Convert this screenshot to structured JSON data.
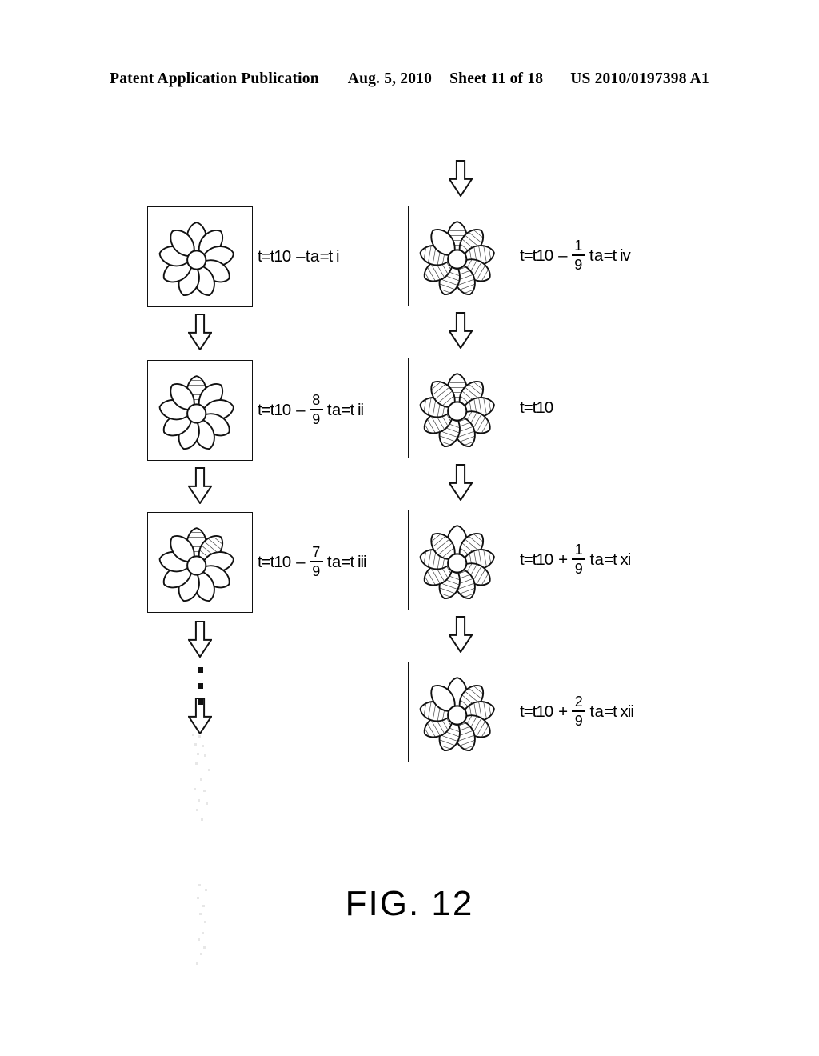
{
  "header": {
    "publication": "Patent Application Publication",
    "date": "Aug. 5, 2010",
    "sheet": "Sheet 11 of 18",
    "number": "US 2010/0197398 A1"
  },
  "figure_caption": "FIG. 12",
  "petal_count": 9,
  "icons": {
    "down_arrow": "down-arrow-icon",
    "vertical_ellipsis": "vertical-ellipsis-icon"
  },
  "colors": {
    "ink": "#111111",
    "paper": "#ffffff"
  },
  "columns": [
    {
      "name": "left-column",
      "cells": [
        {
          "id": "cell-t-i",
          "hatched_petals": 0,
          "label": {
            "prefix": "t=t10",
            "operator": "–",
            "fraction": null,
            "middle": "ta",
            "suffix": "=t i",
            "text": "t=t10 – ta=t i"
          }
        },
        {
          "id": "cell-t-ii",
          "hatched_petals": 1,
          "label": {
            "prefix": "t=t10",
            "operator": "–",
            "fraction": {
              "numerator": "8",
              "denominator": "9"
            },
            "middle": "ta",
            "suffix": "=t ii",
            "text": "t=t10 – 8/9 ta=t ii"
          }
        },
        {
          "id": "cell-t-iii",
          "hatched_petals": 2,
          "label": {
            "prefix": "t=t10",
            "operator": "–",
            "fraction": {
              "numerator": "7",
              "denominator": "9"
            },
            "middle": "ta",
            "suffix": "=t iii",
            "text": "t=t10 – 7/9 ta=t iii"
          }
        }
      ]
    },
    {
      "name": "right-column",
      "cells": [
        {
          "id": "cell-t-iv",
          "hatched_petals": 8,
          "unfilled_petal_index": 8,
          "label": {
            "prefix": "t=t10",
            "operator": "–",
            "fraction": {
              "numerator": "1",
              "denominator": "9"
            },
            "middle": "ta",
            "suffix": "=t iv",
            "text": "t=t10 – 1/9 ta=t iv"
          }
        },
        {
          "id": "cell-t10",
          "hatched_petals": 9,
          "label": {
            "prefix": "t=t10",
            "operator": "",
            "fraction": null,
            "middle": "",
            "suffix": "",
            "text": "t=t10"
          }
        },
        {
          "id": "cell-t-xi",
          "hatched_petals": 8,
          "unfilled_petal_index": 0,
          "label": {
            "prefix": "t=t10",
            "operator": "+",
            "fraction": {
              "numerator": "1",
              "denominator": "9"
            },
            "middle": "ta",
            "suffix": "=t xi",
            "text": "t=t10 + 1/9 ta=t xi"
          }
        },
        {
          "id": "cell-t-xii",
          "hatched_petals": 7,
          "unfilled_petal_index": 0,
          "label": {
            "prefix": "t=t10",
            "operator": "+",
            "fraction": {
              "numerator": "2",
              "denominator": "9"
            },
            "middle": "ta",
            "suffix": "=t xii",
            "text": "t=t10 + 2/9 ta=t xii"
          }
        }
      ]
    }
  ]
}
